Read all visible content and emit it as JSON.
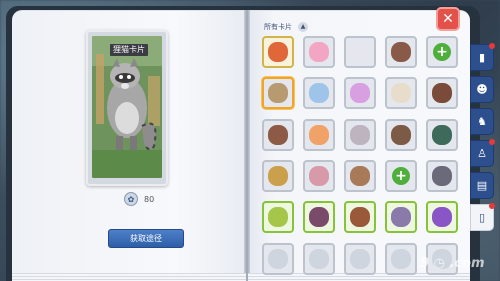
{
  "card": {
    "name": "狸猫卡片",
    "value": "80",
    "obtain_label": "获取途径"
  },
  "filter": {
    "label": "所有卡片",
    "arrow": "▲"
  },
  "grid": {
    "rows": [
      [
        {
          "style": "yellow",
          "color": "#e0673a",
          "icon": "red-haired-character-icon"
        },
        {
          "style": "gray",
          "color": "#f2a6c4",
          "icon": "pink-poring-icon"
        },
        {
          "style": "gray",
          "color": "#e6e6ee",
          "icon": "white-rabbit-icon"
        },
        {
          "style": "gray",
          "color": "#8a5a48",
          "icon": "barrel-icon"
        },
        {
          "style": "plus",
          "color": "",
          "icon": "plus-icon"
        }
      ],
      [
        {
          "style": "sel",
          "color": "#b89a70",
          "icon": "raccoon-icon"
        },
        {
          "style": "gray",
          "color": "#9ec4ea",
          "icon": "blue-creature-icon"
        },
        {
          "style": "gray",
          "color": "#d8a0e0",
          "icon": "angel-poring-icon"
        },
        {
          "style": "gray",
          "color": "#e8dccb",
          "icon": "sheep-icon"
        },
        {
          "style": "gray",
          "color": "#7a4a3a",
          "icon": "chair-icon"
        }
      ],
      [
        {
          "style": "gray",
          "color": "#8d5b45",
          "icon": "stump-icon"
        },
        {
          "style": "gray",
          "color": "#f0a268",
          "icon": "orange-fruit-icon"
        },
        {
          "style": "gray",
          "color": "#bdb4c0",
          "icon": "gray-bat-icon"
        },
        {
          "style": "gray",
          "color": "#7c5a46",
          "icon": "wooden-cart-icon"
        },
        {
          "style": "gray",
          "color": "#3d6a5a",
          "icon": "dark-beast-icon"
        }
      ],
      [
        {
          "style": "gray",
          "color": "#caa04c",
          "icon": "yellow-creature-icon"
        },
        {
          "style": "gray",
          "color": "#d89aa8",
          "icon": "pink-flower-icon"
        },
        {
          "style": "gray",
          "color": "#a87a5a",
          "icon": "monkey-icon"
        },
        {
          "style": "plus",
          "color": "",
          "icon": "plus-icon"
        },
        {
          "style": "gray",
          "color": "#6a6a7a",
          "icon": "armored-knight-icon"
        }
      ],
      [
        {
          "style": "green",
          "color": "#a6c64a",
          "icon": "green-plant-icon"
        },
        {
          "style": "green",
          "color": "#7a4a6a",
          "icon": "purple-bug-icon"
        },
        {
          "style": "green",
          "color": "#9a5a3a",
          "icon": "fox-icon"
        },
        {
          "style": "green",
          "color": "#8a7aaa",
          "icon": "horned-beast-icon"
        },
        {
          "style": "green",
          "color": "#8a56c6",
          "icon": "purple-ghost-icon"
        }
      ],
      [
        {
          "style": "gray",
          "color": "#cfd5de",
          "icon": "card-icon"
        },
        {
          "style": "gray",
          "color": "#cfd5de",
          "icon": "card-icon"
        },
        {
          "style": "gray",
          "color": "#cfd5de",
          "icon": "card-icon"
        },
        {
          "style": "gray",
          "color": "#cfd5de",
          "icon": "card-icon"
        },
        {
          "style": "gray",
          "color": "#cfd5de",
          "icon": "card-icon"
        }
      ]
    ]
  },
  "tabs": [
    {
      "icon": "book-icon",
      "glyph": "▮",
      "dot": true
    },
    {
      "icon": "cat-face-icon",
      "glyph": "☻",
      "dot": false
    },
    {
      "icon": "horse-icon",
      "glyph": "♞",
      "dot": false
    },
    {
      "icon": "bell-icon",
      "glyph": "♙",
      "dot": true
    },
    {
      "icon": "paper-icon",
      "glyph": "▤",
      "dot": false
    },
    {
      "icon": "card-collection-icon",
      "glyph": "▯",
      "dot": true
    }
  ],
  "close": {
    "glyph": "✕"
  },
  "colors": {
    "accent": "#2d4f8e",
    "button": "#3a6cb8",
    "close": "#e2514a",
    "selected": "#f0a526"
  }
}
